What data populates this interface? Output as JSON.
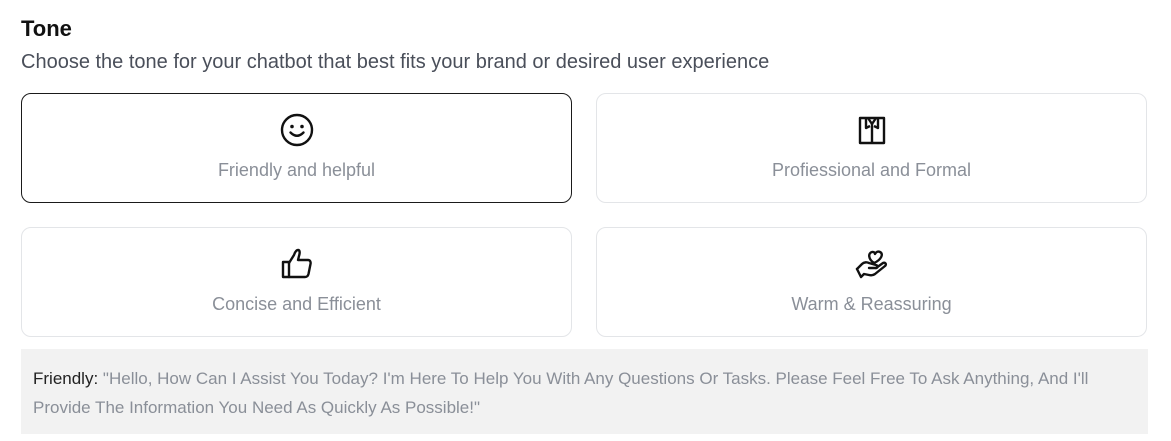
{
  "section": {
    "title": "Tone",
    "subtitle": "Choose the tone for your chatbot that best fits your brand or desired user experience"
  },
  "tones": [
    {
      "label": "Friendly and helpful",
      "icon": "smiley-icon",
      "selected": true
    },
    {
      "label": "Profiessional and Formal",
      "icon": "shirt-tie-icon",
      "selected": false
    },
    {
      "label": "Concise and Efficient",
      "icon": "thumbs-up-icon",
      "selected": false
    },
    {
      "label": "Warm & Reassuring",
      "icon": "hand-heart-icon",
      "selected": false
    }
  ],
  "preview": {
    "lead": "Friendly:",
    "text": "\"Hello, How Can I Assist You Today? I'm Here To Help You With Any Questions Or Tasks. Please Feel Free To Ask Anything, And I'll Provide The Information You Need As Quickly As Possible!\""
  },
  "colors": {
    "selected_border": "#1a1a1a",
    "card_border": "#e3e5e8",
    "label_text": "#8a8f98",
    "preview_bg": "#f2f2f2"
  }
}
